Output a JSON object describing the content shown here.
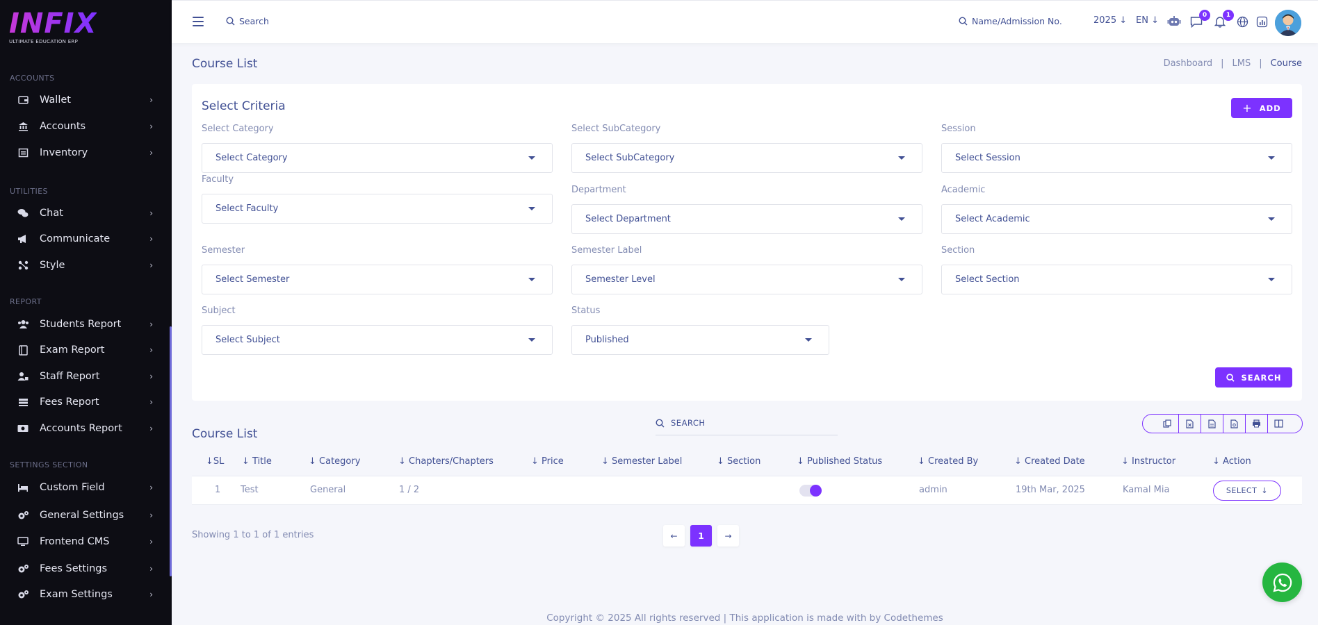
{
  "logo": {
    "word": "INFIX",
    "tagline": "ULTIMATE EDUCATION ERP"
  },
  "sidebar": {
    "sections": [
      {
        "title": "ACCOUNTS",
        "items": [
          "Wallet",
          "Accounts",
          "Inventory"
        ]
      },
      {
        "title": "UTILITIES",
        "items": [
          "Chat",
          "Communicate",
          "Style"
        ]
      },
      {
        "title": "REPORT",
        "items": [
          "Students Report",
          "Exam Report",
          "Staff Report",
          "Fees Report",
          "Accounts Report"
        ]
      },
      {
        "title": "SETTINGS SECTION",
        "items": [
          "Custom Field",
          "General Settings",
          "Frontend CMS",
          "Fees Settings",
          "Exam Settings"
        ]
      }
    ]
  },
  "header": {
    "search_label": "Search",
    "student_search_label": "Name/Admission No.",
    "year": "2025",
    "language": "EN",
    "message_count": "0",
    "notification_count": "1"
  },
  "page": {
    "title": "Course List",
    "breadcrumb": [
      "Dashboard",
      "LMS",
      "Course"
    ]
  },
  "criteria": {
    "title": "Select Criteria",
    "add_label": "ADD",
    "search_label": "SEARCH",
    "fields": {
      "category": {
        "label": "Select Category",
        "value": "Select Category"
      },
      "subcategory": {
        "label": "Select SubCategory",
        "value": "Select SubCategory"
      },
      "session": {
        "label": "Session",
        "value": "Select Session"
      },
      "faculty": {
        "label": "Faculty",
        "value": "Select Faculty"
      },
      "department": {
        "label": "Department",
        "value": "Select Department"
      },
      "academic": {
        "label": "Academic",
        "value": "Select Academic"
      },
      "semester": {
        "label": "Semester",
        "value": "Select Semester"
      },
      "semester_label": {
        "label": "Semester Label",
        "value": "Semester Level"
      },
      "section": {
        "label": "Section",
        "value": "Select Section"
      },
      "subject": {
        "label": "Subject",
        "value": "Select Subject"
      },
      "status": {
        "label": "Status",
        "value": "Published"
      }
    }
  },
  "course_list": {
    "title": "Course List",
    "search_placeholder": "SEARCH",
    "columns": [
      "SL",
      "Title",
      "Category",
      "Chapters/Chapters",
      "Price",
      "Semester Label",
      "Section",
      "Published Status",
      "Created By",
      "Created Date",
      "Instructor",
      "Action"
    ],
    "rows": [
      {
        "sl": "1",
        "title": "Test",
        "category": "General",
        "chapters": "1 / 2",
        "price": "",
        "semester_label": "",
        "section": "",
        "published": true,
        "created_by": "admin",
        "created_date": "19th Mar, 2025",
        "instructor": "Kamal Mia",
        "action": "SELECT"
      }
    ],
    "showing": "Showing 1 to 1 of 1 entries",
    "current_page": "1"
  },
  "footer": {
    "text": "Copyright © 2025 All rights reserved | This application is made with by Codethemes"
  },
  "colors": {
    "accent": "#7c32ff",
    "text": "#415094",
    "muted": "#828bb2",
    "sidebar": "#0d0d14",
    "whatsapp": "#25b640"
  }
}
